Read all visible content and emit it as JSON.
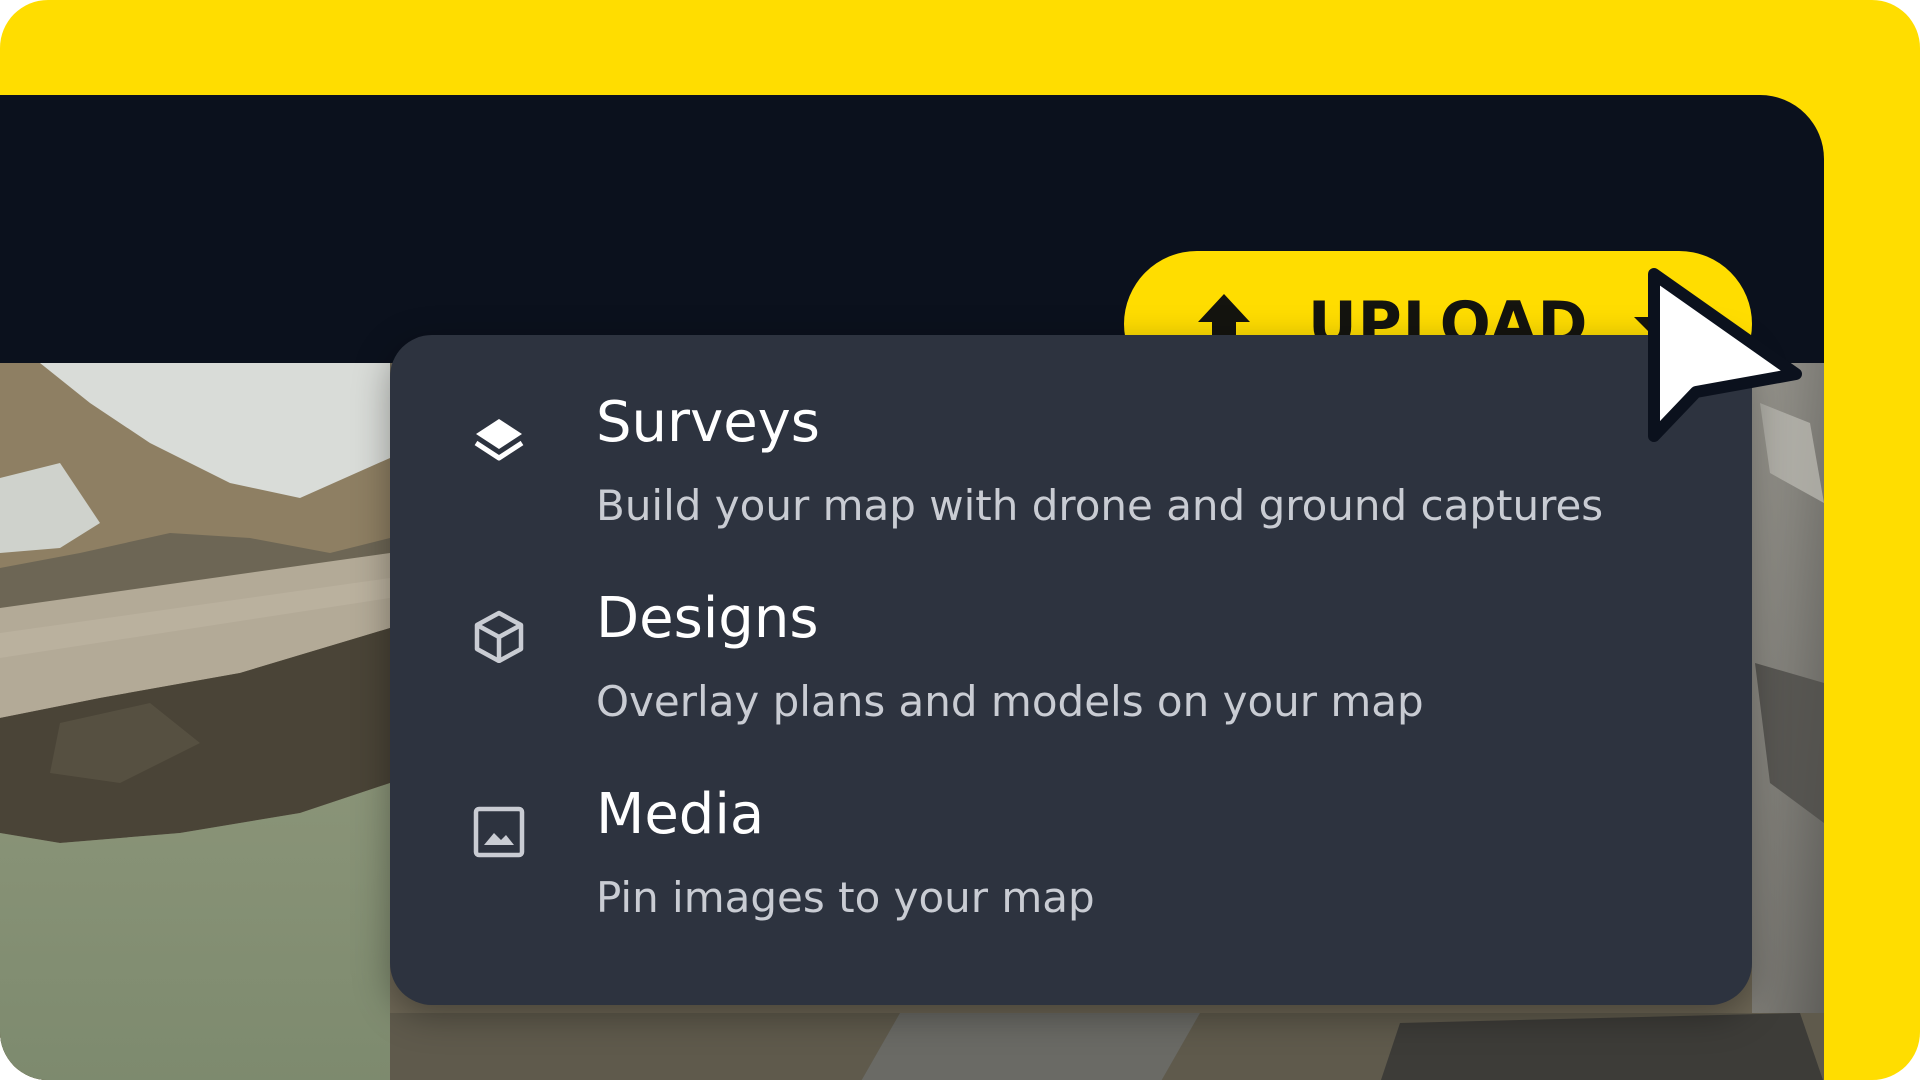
{
  "upload_button": {
    "label": "UPLOAD",
    "icon": "upload-arrow-icon",
    "dropdown_icon": "caret-down-icon"
  },
  "menu": {
    "items": [
      {
        "title": "Surveys",
        "description": "Build your map with drone and ground captures",
        "icon": "layers-icon"
      },
      {
        "title": "Designs",
        "description": "Overlay plans and models on your map",
        "icon": "cube-icon"
      },
      {
        "title": "Media",
        "description": "Pin images to your map",
        "icon": "image-icon"
      }
    ]
  },
  "colors": {
    "accent_yellow": "#FFDD00",
    "app_header": "#0B111D",
    "menu_background": "#2D333F",
    "menu_title": "#FFFFFF",
    "menu_description": "#C9CCD3"
  }
}
